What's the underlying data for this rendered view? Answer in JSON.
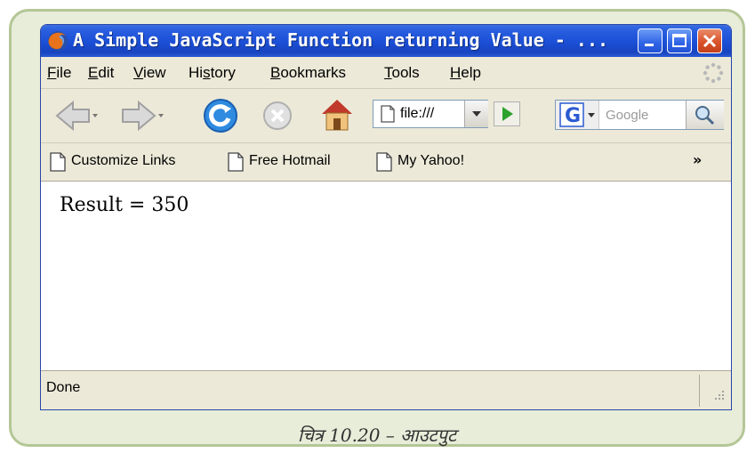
{
  "window": {
    "title": "A Simple JavaScript Function returning Value - ..."
  },
  "menubar": {
    "items": [
      {
        "label": "File",
        "underline": "F"
      },
      {
        "label": "Edit",
        "underline": "E"
      },
      {
        "label": "View",
        "underline": "V"
      },
      {
        "label": "History",
        "underline": "s"
      },
      {
        "label": "Bookmarks",
        "underline": "B"
      },
      {
        "label": "Tools",
        "underline": "T"
      },
      {
        "label": "Help",
        "underline": "H"
      }
    ]
  },
  "navbar": {
    "url": "file:///",
    "search_engine_letter": "G",
    "search_placeholder": "Google"
  },
  "bookmarks": {
    "items": [
      {
        "label": "Customize Links"
      },
      {
        "label": "Free Hotmail"
      },
      {
        "label": "My Yahoo!"
      }
    ],
    "overflow": "»"
  },
  "content": {
    "result_text": "Result = 350"
  },
  "status": {
    "text": "Done"
  },
  "caption": "चित्र 10.20 – आउटपुट",
  "colors": {
    "titlebar": "#1b4fd6",
    "chrome": "#ece9d8",
    "panel_bg": "#e7edd9",
    "panel_border": "#b5c696"
  }
}
